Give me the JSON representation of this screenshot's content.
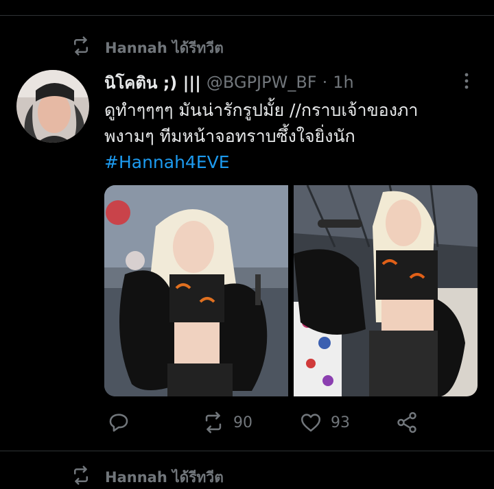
{
  "retweet_context": {
    "label": "Hannah ได้รีทวีต",
    "icon": "retweet-icon"
  },
  "tweet": {
    "display_name": "นิโคติน ;) |||",
    "handle": "@BGPJPW_BF",
    "separator": "·",
    "time": "1h",
    "text_lines": [
      "ดูทำๆๆๆๆ มันน่ารักรูปมั้ย //กราบเจ้าของภา",
      "พงามๆ ทีมหน้าจอทราบซึ้งใจยิ่งนัก"
    ],
    "hashtag": "#Hannah4EVE",
    "media": [
      {
        "alt": "photo-left",
        "description_icon": "image"
      },
      {
        "alt": "photo-right",
        "description_icon": "image"
      }
    ],
    "actions": {
      "reply": {
        "icon": "reply-icon",
        "count": ""
      },
      "retweet": {
        "icon": "retweet-icon",
        "count": "90"
      },
      "like": {
        "icon": "heart-icon",
        "count": "93"
      },
      "share": {
        "icon": "share-icon",
        "count": ""
      }
    }
  },
  "next_retweet_context": {
    "label": "Hannah ได้รีทวีต"
  },
  "colors": {
    "background": "#000000",
    "text": "#e7e9ea",
    "muted": "#71767b",
    "link": "#1d9bf0",
    "divider": "#2f3336"
  }
}
